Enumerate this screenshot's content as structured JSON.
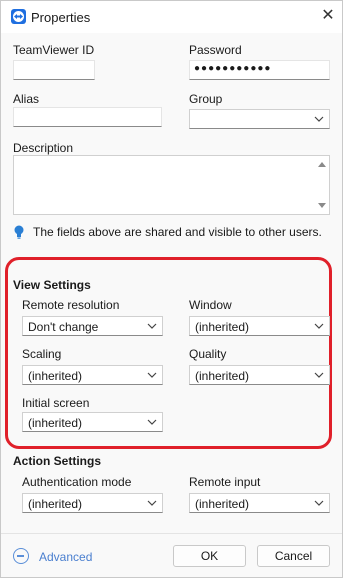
{
  "window": {
    "title": "Properties",
    "close_glyph": "✕",
    "accent": "#1f6fe0",
    "highlight_color": "#e0202a"
  },
  "fields": {
    "teamviewer_id": {
      "label": "TeamViewer ID",
      "value": ""
    },
    "password": {
      "label": "Password",
      "value": "●●●●●●●●●●●"
    },
    "alias": {
      "label": "Alias",
      "value": ""
    },
    "group": {
      "label": "Group",
      "value": ""
    },
    "description": {
      "label": "Description",
      "value": ""
    }
  },
  "info": {
    "icon": "lightbulb-icon",
    "text": "The fields above are shared and visible to other users."
  },
  "view_settings": {
    "heading": "View Settings",
    "remote_resolution": {
      "label": "Remote resolution",
      "value": "Don't change"
    },
    "window": {
      "label": "Window",
      "value": "(inherited)"
    },
    "scaling": {
      "label": "Scaling",
      "value": "(inherited)"
    },
    "quality": {
      "label": "Quality",
      "value": "(inherited)"
    },
    "initial_screen": {
      "label": "Initial screen",
      "value": "(inherited)"
    }
  },
  "action_settings": {
    "heading": "Action Settings",
    "authentication_mode": {
      "label": "Authentication mode",
      "value": "(inherited)"
    },
    "remote_input": {
      "label": "Remote input",
      "value": "(inherited)"
    }
  },
  "footer": {
    "advanced": "Advanced",
    "ok": "OK",
    "cancel": "Cancel"
  }
}
